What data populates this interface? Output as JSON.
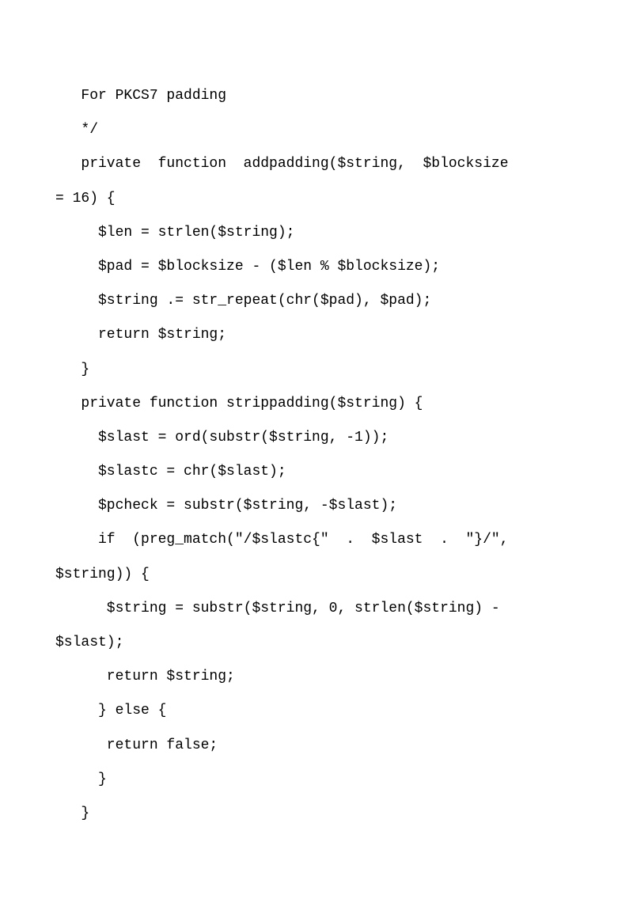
{
  "lines": [
    "   For PKCS7 padding",
    "   */",
    "   private  function  addpadding($string,  $blocksize",
    "= 16) {",
    "     $len = strlen($string);",
    "     $pad = $blocksize - ($len % $blocksize);",
    "     $string .= str_repeat(chr($pad), $pad);",
    "     return $string;",
    "   }",
    "   private function strippadding($string) {",
    "     $slast = ord(substr($string, -1));",
    "     $slastc = chr($slast);",
    "     $pcheck = substr($string, -$slast);",
    "     if  (preg_match(\"/$slastc{\"  .  $slast  .  \"}/\",",
    "$string)) {",
    "      $string = substr($string, 0, strlen($string) -",
    "$slast);",
    "      return $string;",
    "     } else {",
    "      return false;",
    "     }",
    "   }"
  ]
}
